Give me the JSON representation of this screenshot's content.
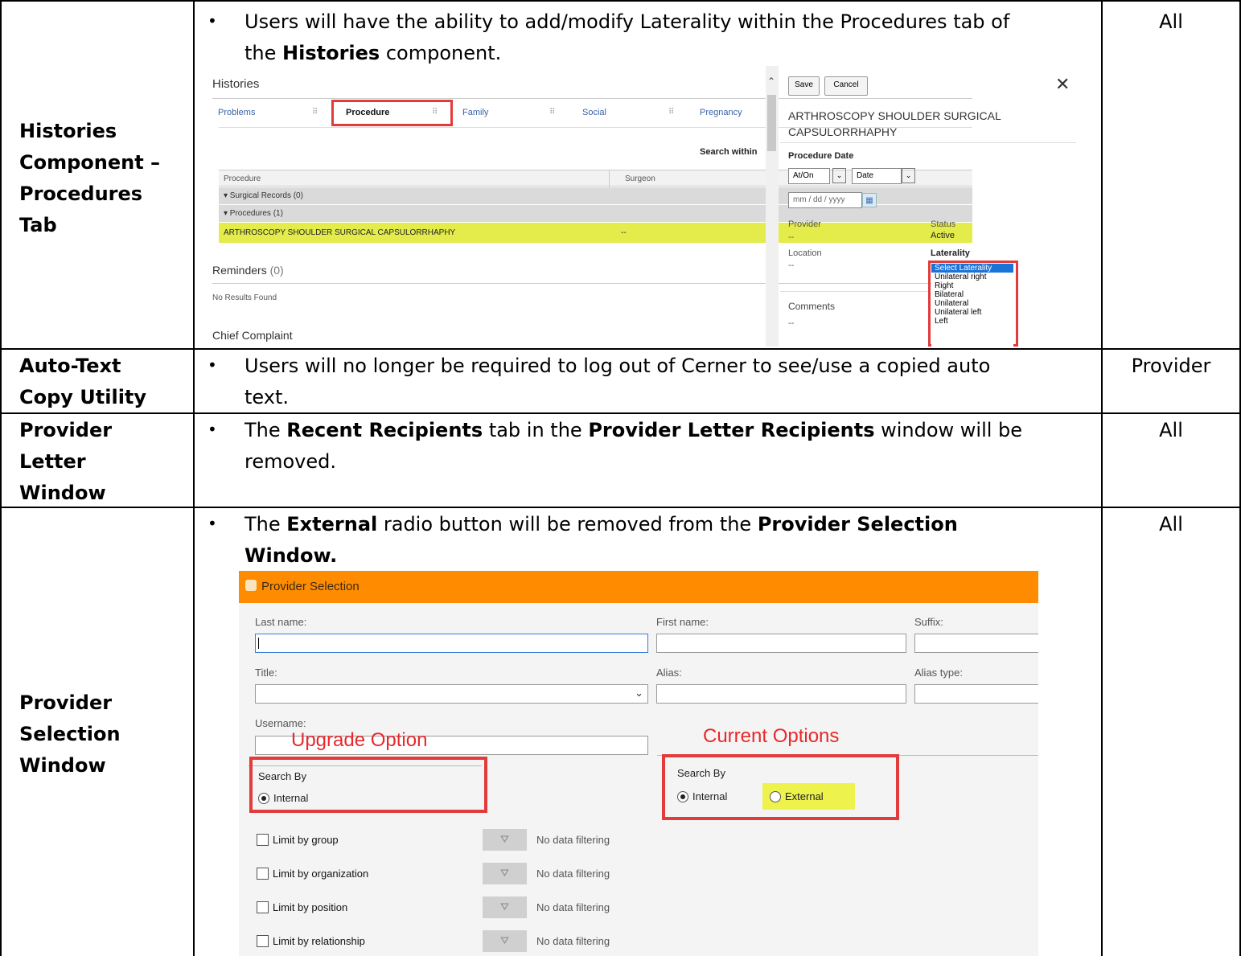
{
  "rows": [
    {
      "label_lines": [
        "Histories",
        "Component –",
        "Procedures",
        "Tab"
      ],
      "bullet_lines": [
        "Users will have the ability to add/modify Laterality within the Procedures tab of"
      ],
      "bullet_line2_pre": "the ",
      "bullet_line2_bold": "Histories",
      "bullet_line2_post": " component.",
      "audience": "All"
    },
    {
      "label_lines": [
        "Auto-Text",
        "Copy Utility"
      ],
      "bullet_lines": [
        "Users will no longer be required to log out of Cerner to see/use a copied auto",
        "text."
      ],
      "audience": "Provider"
    },
    {
      "label_lines": [
        "Provider",
        "Letter",
        "Window"
      ],
      "b_pre": "The ",
      "b_bold1": "Recent Recipients",
      "b_mid": " tab in the ",
      "b_bold2": "Provider Letter Recipients",
      "b_post": " window will be",
      "line2": "removed.",
      "audience": "All"
    },
    {
      "label_lines": [
        "Provider",
        "Selection",
        "Window"
      ],
      "b_pre": "The ",
      "b_bold1": "External",
      "b_mid": " radio button will be removed from the ",
      "b_bold2": "Provider Selection",
      "line2_bold": "Window.",
      "audience": "All"
    }
  ],
  "bullet_char": "•",
  "histories_ss": {
    "title": "Histories",
    "tabs": [
      "Problems",
      "Procedure",
      "Family",
      "Social",
      "Pregnancy"
    ],
    "search_within": "Search within",
    "col_procedure": "Procedure",
    "col_surgeon": "Surgeon",
    "group1": "▾ Surgical Records (0)",
    "group2": "▾ Procedures (1)",
    "selected_row": "ARTHROSCOPY SHOULDER SURGICAL CAPSULORRHAPHY",
    "selected_surgeon": "--",
    "reminders": "Reminders",
    "reminders_count": "(0)",
    "no_results": "No Results Found",
    "chief_complaint": "Chief Complaint",
    "save": "Save",
    "cancel": "Cancel",
    "close": "✕",
    "detail_title_1": "ARTHROSCOPY SHOULDER SURGICAL",
    "detail_title_2": "CAPSULORRHAPHY",
    "procedure_date": "Procedure Date",
    "at_on": "At/On",
    "date": "Date",
    "date_placeholder": "mm / dd / yyyy",
    "provider": "Provider",
    "provider_val": "--",
    "status": "Status",
    "status_val": "Active",
    "location": "Location",
    "location_val": "--",
    "laterality": "Laterality",
    "laterality_options": [
      "Select Laterality",
      "Unilateral right",
      "Right",
      "Bilateral",
      "Unilateral",
      "Unilateral left",
      "Left"
    ],
    "comments": "Comments",
    "comments_val": "--"
  },
  "provider_ss": {
    "title": "Provider Selection",
    "last_name": "Last name:",
    "first_name": "First name:",
    "suffix": "Suffix:",
    "title_field": "Title:",
    "alias": "Alias:",
    "alias_type": "Alias type:",
    "username": "Username:",
    "upgrade_option": "Upgrade Option",
    "current_options": "Current Options",
    "search_by": "Search By",
    "internal": "Internal",
    "external": "External",
    "limits": [
      "Limit by group",
      "Limit by organization",
      "Limit by position",
      "Limit by relationship"
    ],
    "no_data_filtering": "No data filtering"
  },
  "colors": {
    "red": "#e23b3b",
    "orange": "#ff8c00",
    "yellow_highlight": "#e4ec4c",
    "select_blue": "#1a74d8"
  }
}
